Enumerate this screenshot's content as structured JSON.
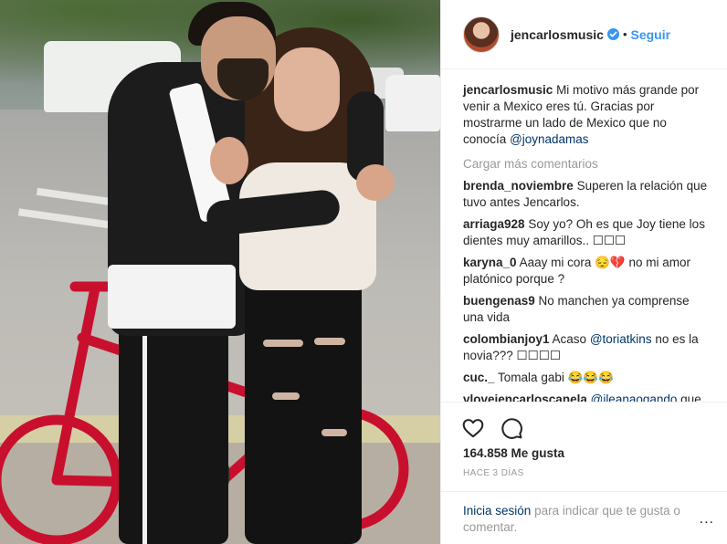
{
  "header": {
    "username": "jencarlosmusic",
    "separator": "•",
    "follow_label": "Seguir"
  },
  "caption": {
    "username": "jencarlosmusic",
    "text": "Mi motivo más grande por venir a Mexico eres tú. Gracias por mostrarme un lado de Mexico que no conocía",
    "mention": "@joynadamas"
  },
  "load_more_label": "Cargar más comentarios",
  "comments": [
    {
      "user": "brenda_noviembre",
      "text": "Superen la relación que tuvo antes Jencarlos."
    },
    {
      "user": "arriaga928",
      "text": "Soy yo? Oh es que Joy tiene los dientes muy amarillos.. ☐☐☐"
    },
    {
      "user": "karyna_0",
      "text": "Aaay mi cora 😔💔 no mi amor platónico porque ?"
    },
    {
      "user": "buengenas9",
      "text": "No manchen ya comprense una vida"
    },
    {
      "user": "colombianjoy1",
      "text_before": "Acaso",
      "mention": "@toriatkins",
      "text_after": "no es la novia??? ☐☐☐☐"
    },
    {
      "user": "cuc._",
      "text": "Tomala gabi 😂😂😂"
    },
    {
      "user": "vloveiencarloscanela",
      "mention": "@ileanaogando",
      "text_after": "que"
    }
  ],
  "likes": "164.858 Me gusta",
  "date": "HACE 3 DÍAS",
  "login": {
    "link": "Inicia sesión",
    "text": "para indicar que te gusta o comentar."
  },
  "more_label": "...",
  "icons": {
    "verified": "verified-badge-icon",
    "like": "heart-icon",
    "comment": "comment-bubble-icon",
    "more": "more-options-icon"
  },
  "colors": {
    "link_blue": "#3897f0",
    "mention_navy": "#003569",
    "muted": "#999999",
    "text": "#262626",
    "bike_red": "#c8102e"
  }
}
